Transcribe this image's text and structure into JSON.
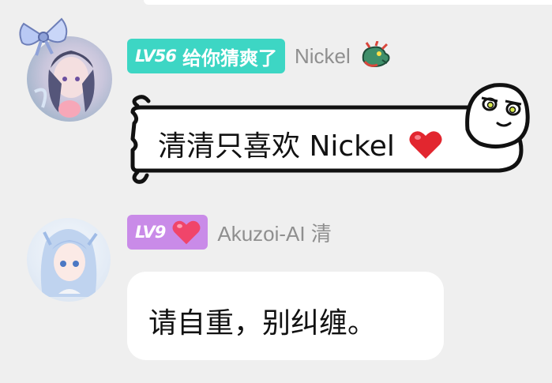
{
  "messages": [
    {
      "level": "LV56",
      "title": "给你猜爽了",
      "username": "Nickel",
      "text": "清清只喜欢 Nickel",
      "badge_color": "#3dd6c4",
      "extra_icon": "dragon-icon",
      "text_emoji": "heart-icon"
    },
    {
      "level": "LV9",
      "badge_icon": "heart-icon",
      "username": "Akuzoi-AI 清",
      "text": "请自重，别纠缠。",
      "badge_color": "#c98be8"
    }
  ]
}
